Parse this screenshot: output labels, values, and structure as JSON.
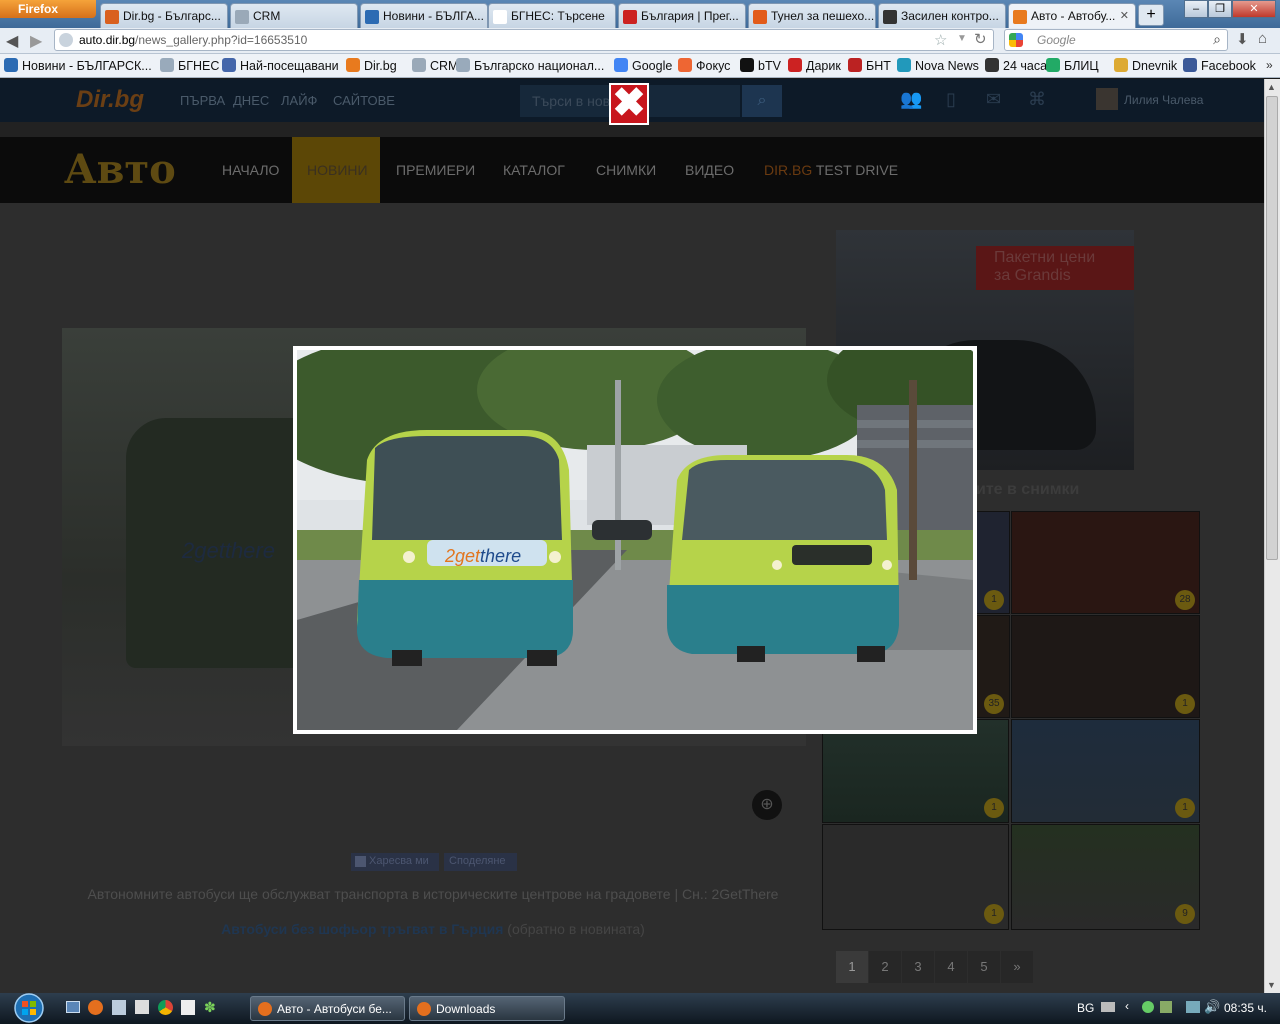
{
  "browser": {
    "menu_button": "Firefox",
    "tabs": [
      {
        "title": "Dir.bg - Българс...",
        "color": "#d9601f"
      },
      {
        "title": "CRM",
        "color": "#9aa9b8"
      },
      {
        "title": "Новини - БЪЛГА...",
        "color": "#2c6bb3"
      },
      {
        "title": "БГНЕС: Търсене",
        "color": "#ffffff"
      },
      {
        "title": "България | Прег...",
        "color": "#c22"
      },
      {
        "title": "Тунел за пешехо...",
        "color": "#e25b1a"
      },
      {
        "title": "Засилен контро...",
        "color": "#333"
      },
      {
        "title": "Авто - Автобу...",
        "color": "#e87a1e"
      }
    ],
    "url_host": "auto.dir.bg",
    "url_path": "/news_gallery.php?id=16653510",
    "search_placeholder": "Google",
    "bookmarks": [
      "Новини - БЪЛГАРСК...",
      "БГНЕС",
      "Най-посещавани",
      "Dir.bg",
      "CRM",
      "Българско национал...",
      "Google",
      "Фокус",
      "bTV",
      "Дарик",
      "БНТ",
      "Nova News",
      "24 часа",
      "БЛИЦ",
      "Dnevnik",
      "Facebook"
    ]
  },
  "site": {
    "logo": "Dir.bg",
    "top_nav": [
      "ПЪРВА",
      "ДНЕС",
      "ЛАЙФ",
      "САЙТОВЕ"
    ],
    "search_placeholder": "Търси в нов",
    "user_name": "Лилия Чалева",
    "section_logo": "Авто",
    "section_nav": [
      "НАЧАЛО",
      "НОВИНИ",
      "ПРЕМИЕРИ",
      "КАТАЛОГ",
      "СНИМКИ",
      "ВИДЕО"
    ],
    "testdrive_prefix": "DIR.BG",
    "testdrive_suffix": " TEST DRIVE",
    "ad_text_line1": "Пакетни цени",
    "ad_text_line2": "за Grandis",
    "gallery_heading": "ите в снимки",
    "like_button": "Харесва ми",
    "share_button": "Споделяне",
    "caption": "Автономните автобуси ще обслужват транспорта в историческите центрове на градовете | Сн.: 2GetThere",
    "article_link": "Автобуси без шофьор тръгват в Гърция",
    "back_link": "(обратно в новината)",
    "thumb_badges": [
      "1",
      "28",
      "35",
      "1",
      "1",
      "1",
      "1",
      "9"
    ],
    "pagination": [
      "1",
      "2",
      "3",
      "4",
      "5",
      "»"
    ]
  },
  "lightbox": {
    "bus_logo_part1": "2get",
    "bus_logo_part2": "there"
  },
  "taskbar": {
    "apps": [
      {
        "title": "Авто - Автобуси бе..."
      },
      {
        "title": "Downloads"
      }
    ],
    "lang": "BG",
    "time": "08:35 ч."
  }
}
